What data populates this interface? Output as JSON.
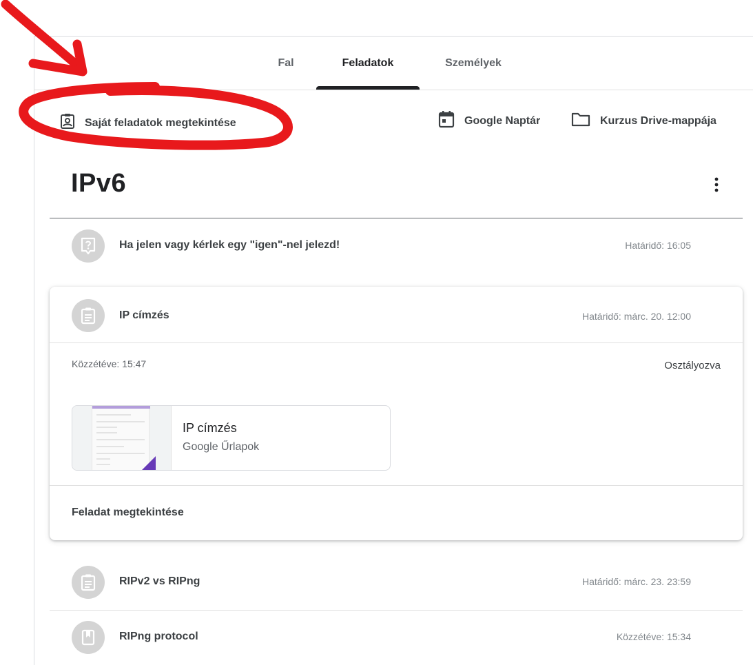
{
  "tabs": [
    {
      "label": "Fal",
      "active": false
    },
    {
      "label": "Feladatok",
      "active": true
    },
    {
      "label": "Személyek",
      "active": false
    }
  ],
  "toolbar": {
    "my_work_label": "Saját feladatok megtekintése",
    "calendar_label": "Google Naptár",
    "drive_label": "Kurzus Drive-mappája"
  },
  "topic": {
    "title": "IPv6"
  },
  "items": [
    {
      "title": "Ha jelen vagy kérlek egy \"igen\"-nel jelezd!",
      "meta": "Határidő: 16:05",
      "icon": "question-icon"
    },
    {
      "title": "IP címzés",
      "meta": "Határidő: márc. 20. 12:00",
      "icon": "assignment-icon"
    },
    {
      "title": "RIPv2 vs RIPng",
      "meta": "Határidő: márc. 23. 23:59",
      "icon": "assignment-icon"
    },
    {
      "title": "RIPng protocol",
      "meta": "Közzétéve: 15:34",
      "icon": "material-icon"
    }
  ],
  "expanded": {
    "posted": "Közzétéve: 15:47",
    "status": "Osztályozva",
    "attachment": {
      "title": "IP címzés",
      "subtitle": "Google Űrlapok"
    },
    "view_link": "Feladat megtekintése"
  },
  "colors": {
    "annotation": "#e8191c",
    "forms_accent": "#673ab7",
    "icon_bg": "#d4d4d4"
  }
}
